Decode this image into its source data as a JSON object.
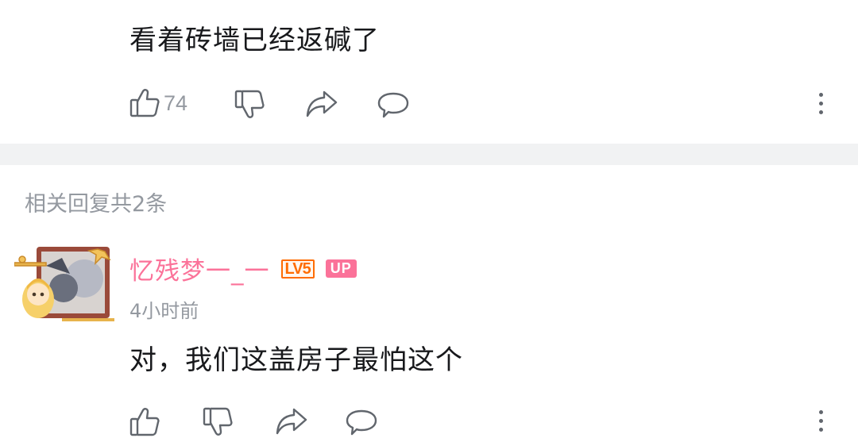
{
  "top_comment": {
    "text": "看着砖墙已经返碱了",
    "like_count": "74"
  },
  "replies_header": "相关回复共2条",
  "reply": {
    "username": "忆残梦一_一",
    "level_badge": "LV5",
    "up_badge": "UP",
    "time": "4小时前",
    "text": "对，我们这盖房子最怕这个"
  },
  "colors": {
    "username": "#fb7299",
    "level": "#ff6c00",
    "muted": "#9499a0",
    "divider": "#f1f2f3"
  },
  "icons": [
    "thumbs-up-icon",
    "thumbs-down-icon",
    "share-icon",
    "comment-icon",
    "more-vertical-icon",
    "avatar"
  ]
}
